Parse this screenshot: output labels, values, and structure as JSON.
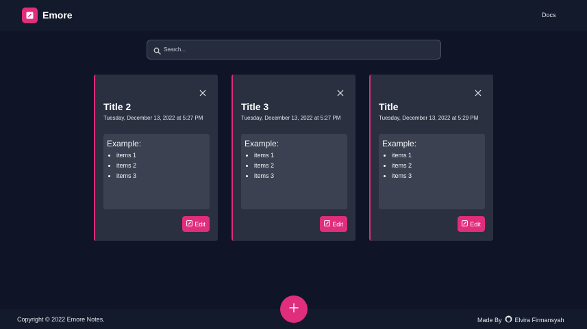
{
  "nav": {
    "brand": "Emore",
    "docs_label": "Docs"
  },
  "search": {
    "placeholder": "Search...",
    "value": ""
  },
  "notes": [
    {
      "title": "Title 2",
      "date": "Tuesday, December 13, 2022 at 5:27 PM",
      "heading": "Example:",
      "items": [
        "items 1",
        "items 2",
        "items 3"
      ],
      "edit_label": "Edit"
    },
    {
      "title": "Title 3",
      "date": "Tuesday, December 13, 2022 at 5:27 PM",
      "heading": "Example:",
      "items": [
        "items 1",
        "items 2",
        "items 3"
      ],
      "edit_label": "Edit"
    },
    {
      "title": "Title",
      "date": "Tuesday, December 13, 2022 at 5:29 PM",
      "heading": "Example:",
      "items": [
        "items 1",
        "items 2",
        "items 3"
      ],
      "edit_label": "Edit"
    }
  ],
  "footer": {
    "copyright": "Copyright © 2022 Emore Notes.",
    "made_by": "Made By",
    "author": "Elvira Firmansyah"
  },
  "icons": {
    "logo": "note-pencil-icon",
    "search": "search-icon",
    "close": "close-icon",
    "edit": "edit-icon",
    "github": "github-icon",
    "add": "plus-icon"
  },
  "colors": {
    "accent": "#e02d7c",
    "background": "#0f1526",
    "card": "#2b3040",
    "card_body": "#3c4151"
  }
}
